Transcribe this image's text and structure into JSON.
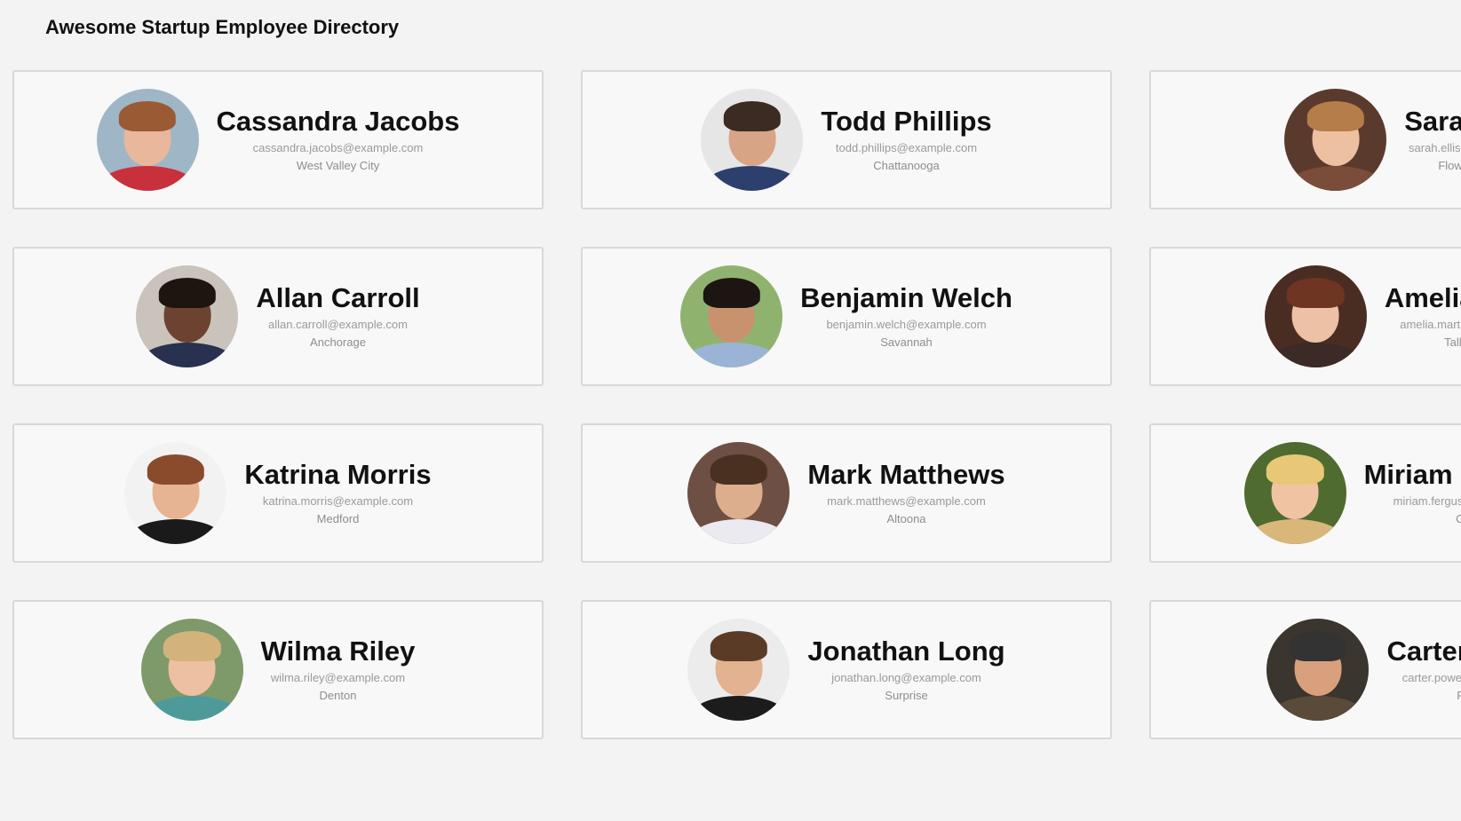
{
  "header": {
    "title": "Awesome Startup Employee Directory"
  },
  "employees": [
    {
      "name": "Cassandra Jacobs",
      "email": "cassandra.jacobs@example.com",
      "city": "West Valley City",
      "avatar_bg": "#9fb6c6",
      "skin": "#e9b79b",
      "hair": "#9a5a33",
      "shirt": "#c8313c"
    },
    {
      "name": "Todd Phillips",
      "email": "todd.phillips@example.com",
      "city": "Chattanooga",
      "avatar_bg": "#e6e6e6",
      "skin": "#d7a486",
      "hair": "#3b2b22",
      "shirt": "#2d3f6c"
    },
    {
      "name": "Sarah Ellis",
      "email": "sarah.ellis@example.com",
      "city": "Flower Mound",
      "avatar_bg": "#5b3a2e",
      "skin": "#edc0a1",
      "hair": "#b47d4a",
      "shirt": "#7a4c3a"
    },
    {
      "name": "Allan Carroll",
      "email": "allan.carroll@example.com",
      "city": "Anchorage",
      "avatar_bg": "#c9c3bb",
      "skin": "#6b4330",
      "hair": "#1e1410",
      "shirt": "#28314f"
    },
    {
      "name": "Benjamin Welch",
      "email": "benjamin.welch@example.com",
      "city": "Savannah",
      "avatar_bg": "#8fb36f",
      "skin": "#c9926f",
      "hair": "#1d1511",
      "shirt": "#9bb4d6"
    },
    {
      "name": "Amelia Martin",
      "email": "amelia.martin@example.com",
      "city": "Tallahassee",
      "avatar_bg": "#4a2d22",
      "skin": "#edc1a6",
      "hair": "#6e3522",
      "shirt": "#3b2a25"
    },
    {
      "name": "Katrina Morris",
      "email": "katrina.morris@example.com",
      "city": "Medford",
      "avatar_bg": "#f2f2f2",
      "skin": "#e7b493",
      "hair": "#8a4a2c",
      "shirt": "#1a1a1a"
    },
    {
      "name": "Mark Matthews",
      "email": "mark.matthews@example.com",
      "city": "Altoona",
      "avatar_bg": "#6d4f44",
      "skin": "#dcae8d",
      "hair": "#4a3020",
      "shirt": "#eaeaf0"
    },
    {
      "name": "Miriam Ferguson",
      "email": "miriam.ferguson@example.com",
      "city": "Corona",
      "avatar_bg": "#4f6b2f",
      "skin": "#f0c3a3",
      "hair": "#e8c877",
      "shirt": "#d9b77a"
    },
    {
      "name": "Wilma Riley",
      "email": "wilma.riley@example.com",
      "city": "Denton",
      "avatar_bg": "#7f9a6a",
      "skin": "#ecc0a0",
      "hair": "#d4b27c",
      "shirt": "#4e9a9a"
    },
    {
      "name": "Jonathan Long",
      "email": "jonathan.long@example.com",
      "city": "Surprise",
      "avatar_bg": "#ececec",
      "skin": "#e2b291",
      "hair": "#5a3b26",
      "shirt": "#1c1c1c"
    },
    {
      "name": "Carter Powell",
      "email": "carter.powell@example.com",
      "city": "Pueblo",
      "avatar_bg": "#3a352e",
      "skin": "#d8a07c",
      "hair": "#333333",
      "shirt": "#5a4a3a"
    }
  ]
}
